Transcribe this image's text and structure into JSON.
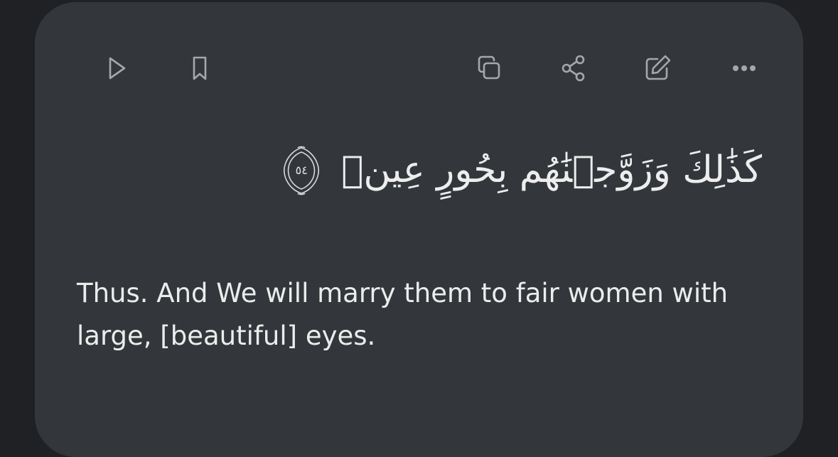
{
  "verse": {
    "arabic": "كَذَٰلِكَ وَزَوَّجۡنَٰهُم بِحُورٍ عِينٖ",
    "number_arabic": "٥٤",
    "translation": "Thus. And We will marry them to fair women with large, [beautiful] eyes."
  },
  "toolbar": {
    "icons": [
      "play-icon",
      "bookmark-icon",
      "copy-icon",
      "share-icon",
      "edit-icon",
      "more-icon"
    ]
  },
  "colors": {
    "background": "#202124",
    "card": "#33373b",
    "icon": "#a4a8ac",
    "text": "#ececec"
  }
}
